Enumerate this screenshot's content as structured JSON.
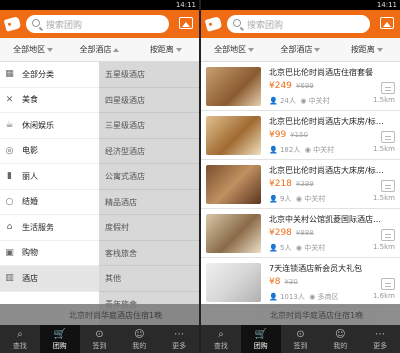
{
  "status": {
    "time": "14:11"
  },
  "search": {
    "placeholder": "搜索团购"
  },
  "filters": {
    "region": "全部地区",
    "category": "全部酒店",
    "sort": "按距离"
  },
  "left": {
    "categories": [
      {
        "label": "全部分类",
        "icon": "grid-icon"
      },
      {
        "label": "美食",
        "icon": "utensils-icon"
      },
      {
        "label": "休闲娱乐",
        "icon": "cup-icon"
      },
      {
        "label": "电影",
        "icon": "film-icon"
      },
      {
        "label": "丽人",
        "icon": "lipstick-icon"
      },
      {
        "label": "结婚",
        "icon": "ring-icon"
      },
      {
        "label": "生活服务",
        "icon": "home-icon"
      },
      {
        "label": "购物",
        "icon": "bag-icon"
      },
      {
        "label": "酒店",
        "icon": "building-icon"
      }
    ],
    "subcategories": [
      "五星级酒店",
      "四星级酒店",
      "三星级酒店",
      "经济型酒店",
      "公寓式酒店",
      "精品酒店",
      "度假村",
      "客栈旅舍",
      "其他",
      "青年旅舍"
    ],
    "peek_text": "北京时尚华庭酒店住宿1晚"
  },
  "right": {
    "items": [
      {
        "title": "北京巴比伦时尚酒店住宿套餐",
        "price": "¥249",
        "orig": "¥699",
        "people": "24人",
        "area": "中关村",
        "dist": "1.5km"
      },
      {
        "title": "北京巴比伦时尚酒店大床房/标…",
        "price": "¥99",
        "orig": "¥150",
        "people": "182人",
        "area": "中关村",
        "dist": "1.5km"
      },
      {
        "title": "北京巴比伦时尚酒店大床房/标…",
        "price": "¥218",
        "orig": "¥399",
        "people": "9人",
        "area": "中关村",
        "dist": "1.5km"
      },
      {
        "title": "北京中关村公馆凯菱国际酒店…",
        "price": "¥298",
        "orig": "¥888",
        "people": "5人",
        "area": "中关村",
        "dist": "1.5km"
      },
      {
        "title": "7天连锁酒店新会员大礼包",
        "price": "¥8",
        "orig": "¥30",
        "people": "1013人",
        "area": "多商区",
        "dist": "1.6km"
      }
    ],
    "peek_text": "北京时尚华庭酒店住宿1晚"
  },
  "nav": [
    {
      "label": "查找",
      "icon": "search-icon"
    },
    {
      "label": "团购",
      "icon": "cart-icon"
    },
    {
      "label": "签到",
      "icon": "pin-icon"
    },
    {
      "label": "我的",
      "icon": "user-icon"
    },
    {
      "label": "更多",
      "icon": "more-icon"
    }
  ]
}
